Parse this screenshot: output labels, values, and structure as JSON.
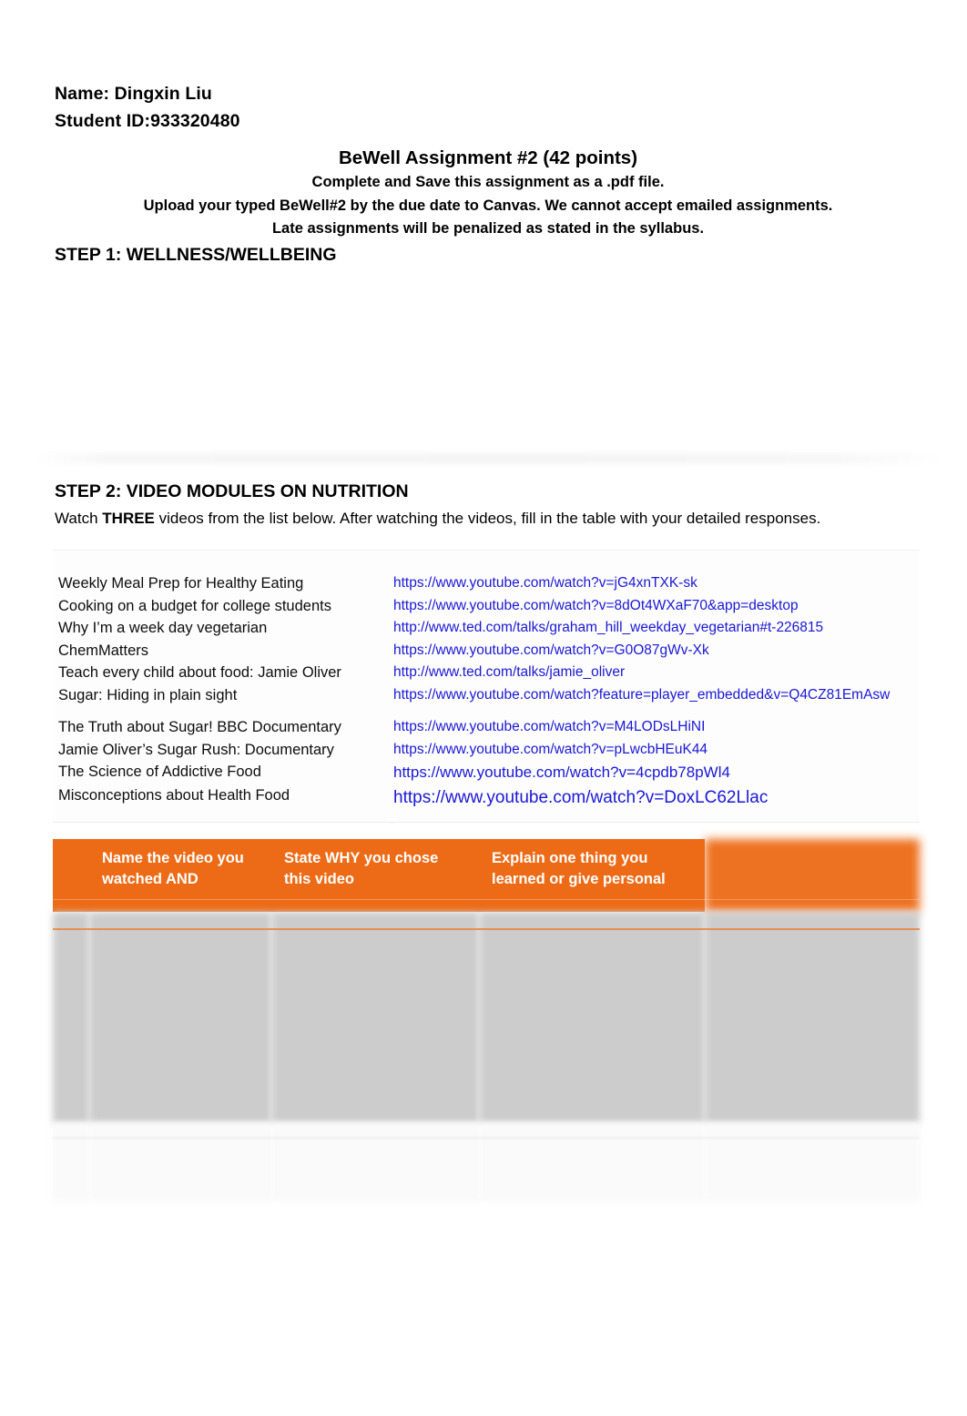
{
  "document": {
    "student_name_line": "Name: Dingxin Liu",
    "student_id_line": "Student ID:933320480",
    "assignment_title": "BeWell Assignment #2 (42 points)",
    "instructions": [
      "Complete and Save this assignment as a .pdf file.",
      "Upload your typed BeWell#2 by the due date to Canvas. We cannot accept emailed assignments.",
      "Late assignments will be penalized as stated in the syllabus."
    ],
    "step1_heading": "STEP 1: WELLNESS/WELLBEING",
    "step2_heading": "STEP 2: VIDEO MODULES ON NUTRITION",
    "watch_note": {
      "before": "Watch ",
      "emphasis": "THREE",
      "after": " videos from the list below. After watching the videos, fill in the table with your detailed responses."
    }
  },
  "colors": {
    "header_orange": "#ED6B17",
    "link_blue": "#1A18D6",
    "body_gray": "#CCCCCC",
    "text_black": "#000000"
  },
  "video_list": [
    {
      "title": "Weekly Meal Prep for Healthy Eating",
      "url": "https://www.youtube.com/watch?v=jG4xnTXK-sk"
    },
    {
      "title": "Cooking on a budget for college students",
      "url": "https://www.youtube.com/watch?v=8dOt4WXaF70&app=desktop"
    },
    {
      "title": "Why I’m a week day vegetarian",
      "url": "http://www.ted.com/talks/graham_hill_weekday_vegetarian#t-226815"
    },
    {
      "title": "ChemMatters",
      "url": "https://www.youtube.com/watch?v=G0O87gWv-Xk"
    },
    {
      "title": "Teach every child about food: Jamie Oliver",
      "url": "http://www.ted.com/talks/jamie_oliver"
    },
    {
      "title": "Sugar: Hiding in plain sight",
      "url": "https://www.youtube.com/watch?feature=player_embedded&v=Q4CZ81EmAsw"
    },
    {
      "title": "The Truth about Sugar! BBC Documentary",
      "url": "https://www.youtube.com/watch?v=M4LODsLHiNI"
    },
    {
      "title": "Jamie Oliver’s Sugar Rush: Documentary",
      "url": "https://www.youtube.com/watch?v=pLwcbHEuK44"
    },
    {
      "title": "The Science of Addictive Food",
      "url": "https://www.youtube.com/watch?v=4cpdb78pWl4"
    },
    {
      "title": "Misconceptions about Health Food",
      "url": "https://www.youtube.com/watch?v=DoxLC62Llac"
    }
  ],
  "response_table": {
    "headers": {
      "number": "",
      "name": "Name the video you watched AND",
      "why": "State WHY you chose this video",
      "learned": "Explain one thing you learned or give personal",
      "last": ""
    },
    "rows": [
      {
        "number": "",
        "name": "",
        "why": "",
        "learned": "",
        "last": ""
      },
      {
        "number": "",
        "name": "",
        "why": "",
        "learned": "",
        "last": ""
      }
    ]
  }
}
